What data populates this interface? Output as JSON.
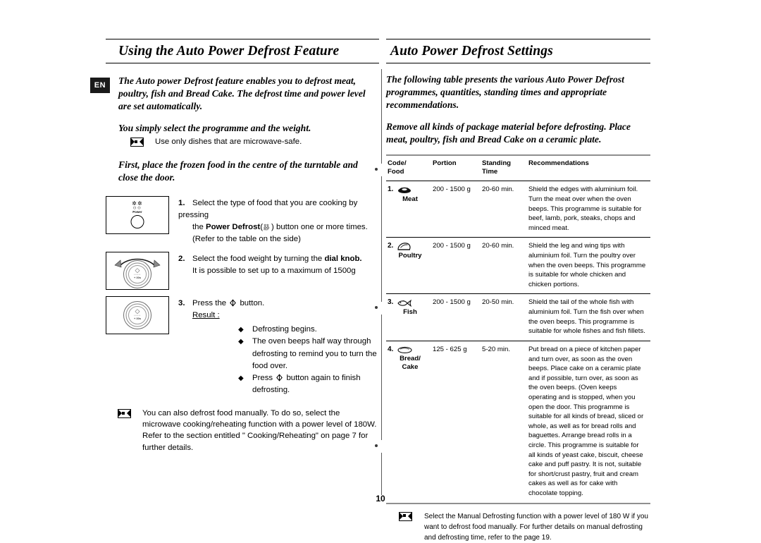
{
  "page": {
    "number": "10",
    "language_badge": "EN"
  },
  "left": {
    "heading": "Using the Auto Power Defrost Feature",
    "intro1": "The Auto power Defrost feature enables you to defrost meat, poultry, fish and Bread Cake. The defrost time and power level are set automatically.",
    "intro2": "You simply select the programme and the weight.",
    "note1": "Use only dishes that are microwave-safe.",
    "intro3": "First, place the frozen food in the centre of the turntable and close the door.",
    "steps": [
      {
        "num": "1.",
        "line1_a": "Select the type of food that you are cooking by pressing",
        "line2_a": "the ",
        "line2_bold": "Power Defrost",
        "line2_b": " button one or more times.",
        "line3": "(Refer to the table on the side)",
        "illustration": "power-defrost-button-panel",
        "panel_label": "Power"
      },
      {
        "num": "2.",
        "line1_a": "Select the food weight by turning the ",
        "line1_bold": "dial knob.",
        "line2": "It is possible to set up to a maximum of 1500g",
        "illustration": "dial-knob-rotating"
      },
      {
        "num": "3.",
        "line1_a": "Press the ",
        "line1_b": " button.",
        "result_label": "Result :",
        "results": [
          "Defrosting begins.",
          "The oven beeps half way through defrosting to remind you to turn the food over.",
          "Press          button again to finish defrosting."
        ],
        "illustration": "dial-knob-start-button"
      }
    ],
    "note2": "You can also defrost food manually. To do so, select the microwave cooking/reheating function with a power level of 180W. Refer to the section entitled \" Cooking/Reheating\" on page 7 for further details."
  },
  "right": {
    "heading": "Auto Power Defrost Settings",
    "intro1": "The following table presents the various Auto Power Defrost programmes, quantities, standing times and appropriate recommendations.",
    "intro2": "Remove all kinds of package material before defrosting. Place meat, poultry, fish and Bread Cake on a ceramic plate.",
    "table": {
      "headers": [
        "Code/ Food",
        "Portion",
        "Standing Time",
        "Recommendations"
      ],
      "header_code_line1": "Code/",
      "header_code_line2": "Food",
      "header_portion": "Portion",
      "header_standing_line1": "Standing",
      "header_standing_line2": "Time",
      "header_recommendations": "Recommendations",
      "rows": [
        {
          "num": "1.",
          "food": "Meat",
          "icon": "meat-icon",
          "portion": "200 - 1500 g",
          "standing_time": "20-60 min.",
          "recommendation": "Shield the edges with aluminium foil. Turn the meat over when the oven beeps. This programme is suitable for beef, lamb, pork, steaks, chops and minced meat."
        },
        {
          "num": "2.",
          "food": "Poultry",
          "icon": "poultry-icon",
          "portion": "200 - 1500 g",
          "standing_time": "20-60 min.",
          "recommendation": "Shield the leg and wing tips with aluminium foil. Turn the poultry over when the oven beeps. This programme is suitable for whole chicken and chicken portions."
        },
        {
          "num": "3.",
          "food": "Fish",
          "icon": "fish-icon",
          "portion": "200 - 1500 g",
          "standing_time": "20-50 min.",
          "recommendation": "Shield the tail of the whole fish with aluminium foil. Turn the fish over when the oven beeps. This programme is suitable for whole fishes and fish fillets."
        },
        {
          "num": "4.",
          "food": "Bread/ Cake",
          "food_line1": "Bread/",
          "food_line2": "Cake",
          "icon": "bread-icon",
          "portion": "125 - 625 g",
          "standing_time": "5-20 min.",
          "recommendation": "Put bread on a piece of kitchen paper and turn over, as soon as the oven beeps. Place cake on a ceramic plate and if possible, turn over, as soon as the oven beeps. (Oven keeps operating and is stopped, when you open the door. This programme is suitable for all kinds of bread, sliced or whole, as well as for bread rolls and baguettes. Arrange bread rolls in a circle. This programme is suitable for all kinds of yeast cake, biscuit, cheese cake and puff pastry. It is not, suitable for short/crust pastry, fruit and cream cakes as well as for cake with chocolate topping."
        }
      ]
    },
    "note": "Select the Manual Defrosting function with a power level of 180 W if you want to defrost food manually. For further details on manual defrosting and defrosting time, refer to the page 19."
  },
  "colors": {
    "text": "#000000",
    "badge_bg": "#1a1a1a",
    "rule": "#8f8f8f",
    "divider": "#5a5a5a"
  }
}
